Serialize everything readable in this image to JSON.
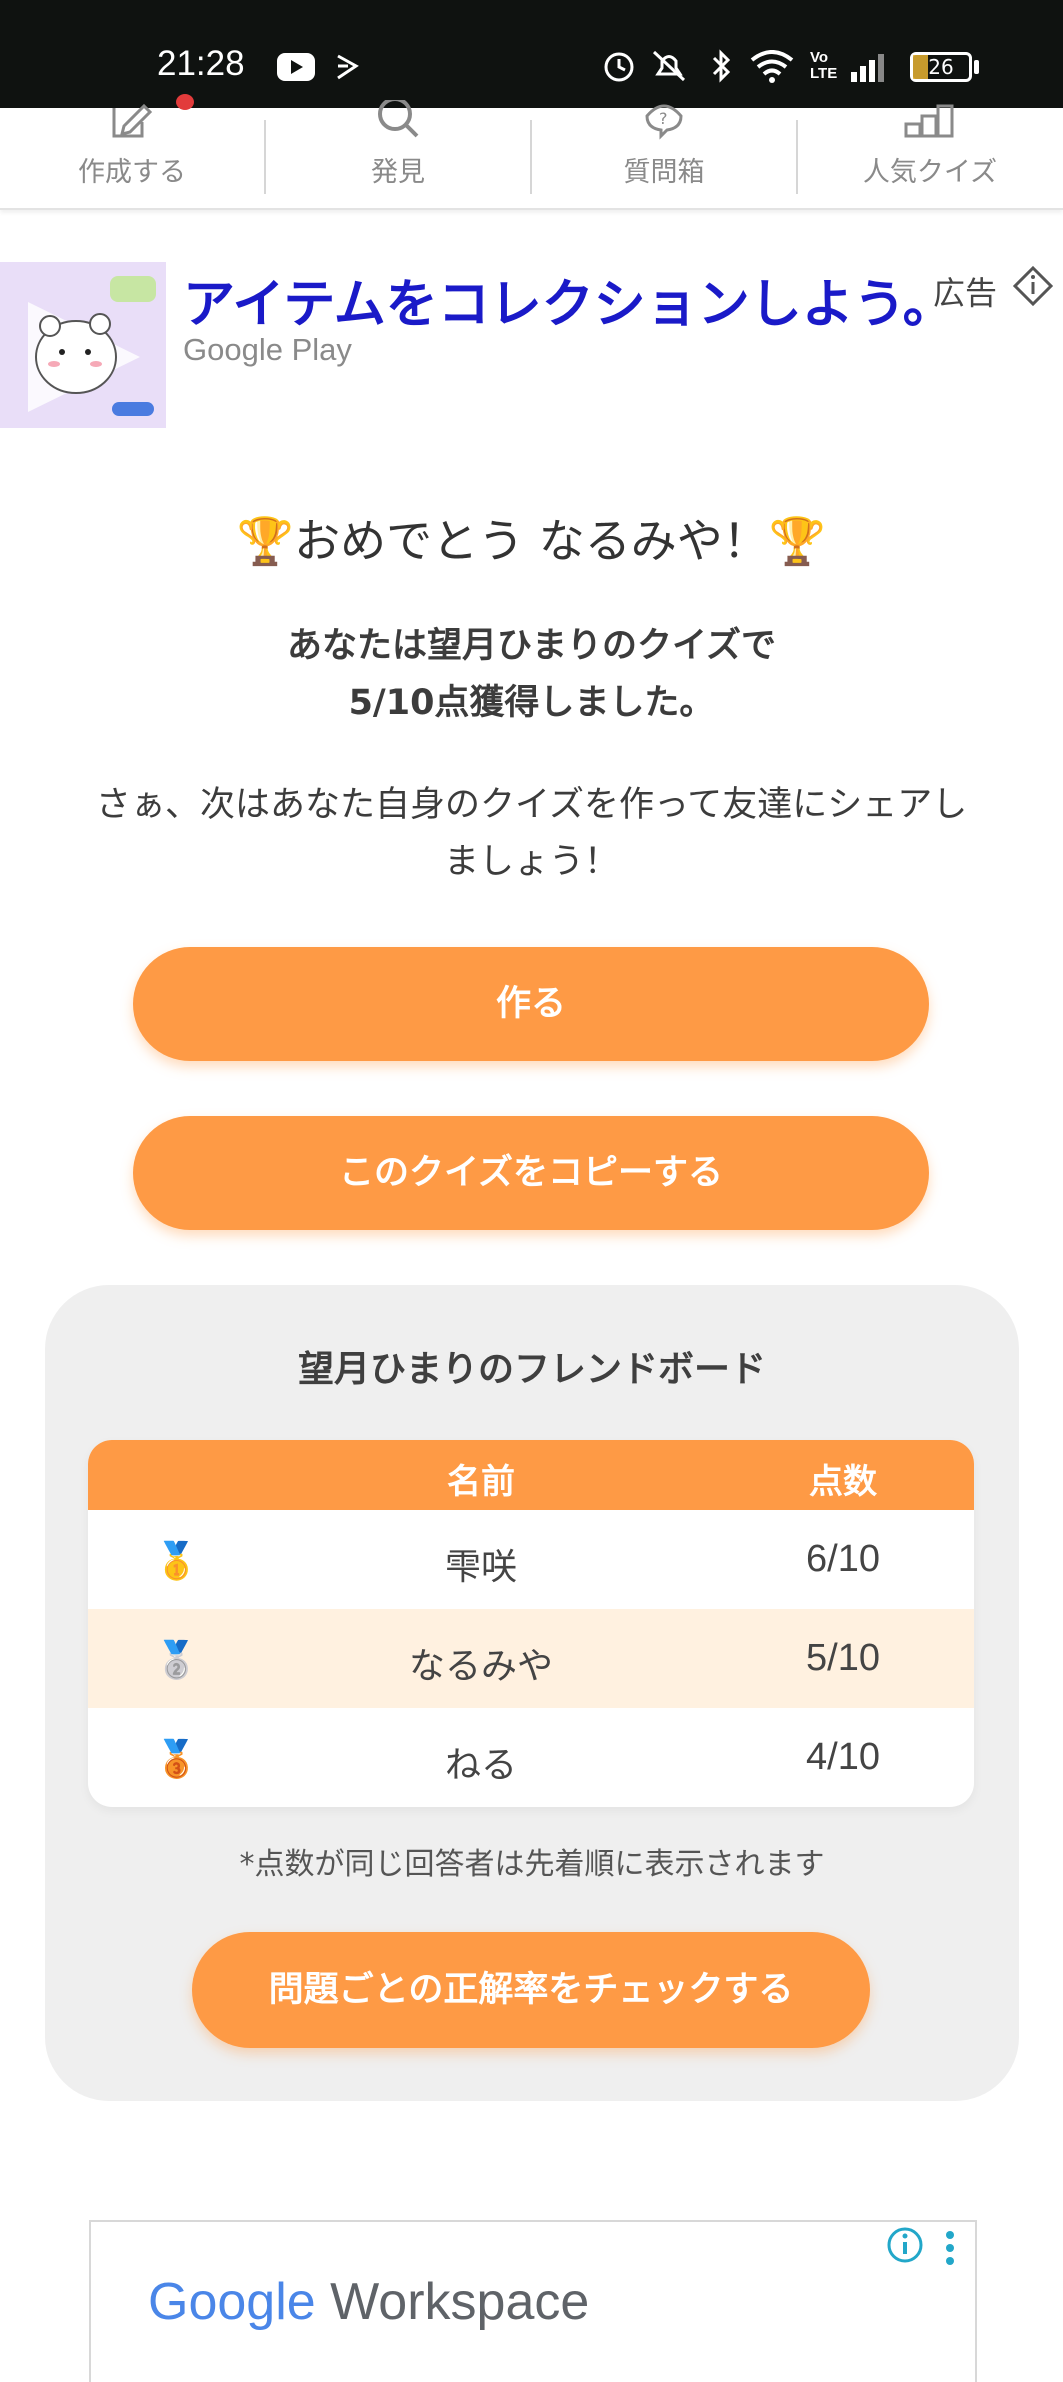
{
  "status_bar": {
    "time": "21:28",
    "battery": "26"
  },
  "nav": {
    "items": [
      {
        "label": "作成する",
        "icon": "edit-icon"
      },
      {
        "label": "発見",
        "icon": "search-icon"
      },
      {
        "label": "質問箱",
        "icon": "question-icon"
      },
      {
        "label": "人気クイズ",
        "icon": "ranking-icon"
      }
    ]
  },
  "ad": {
    "title": "アイテムをコレクションしよう。",
    "advertiser": "Google Play",
    "label": "広告"
  },
  "result": {
    "congrats": "🏆おめでとう なるみや！🏆",
    "line1": "あなたは望月ひまりのクイズで",
    "line2": "5/10点獲得しました。",
    "cta_line1": "さぁ、次はあなた自身のクイズを作って友達にシェアし",
    "cta_line2": "ましょう！"
  },
  "buttons": {
    "create": "作る",
    "copy": "このクイズをコピーする",
    "check": "問題ごとの正解率をチェックする"
  },
  "board": {
    "title": "望月ひまりのフレンドボード",
    "col_name": "名前",
    "col_score": "点数",
    "rows": [
      {
        "medal": "🥇",
        "name": "雫咲",
        "score": "6/10"
      },
      {
        "medal": "🥈",
        "name": "なるみや",
        "score": "5/10"
      },
      {
        "medal": "🥉",
        "name": "ねる",
        "score": "4/10"
      }
    ],
    "note": "*点数が同じ回答者は先着順に表示されます"
  },
  "bottom_ad": {
    "brand": "Google",
    "product": "Workspace"
  },
  "colors": {
    "accent": "#fe9a45",
    "highlight_row": "#fff1e0",
    "ad_title": "#1a1ac8"
  }
}
